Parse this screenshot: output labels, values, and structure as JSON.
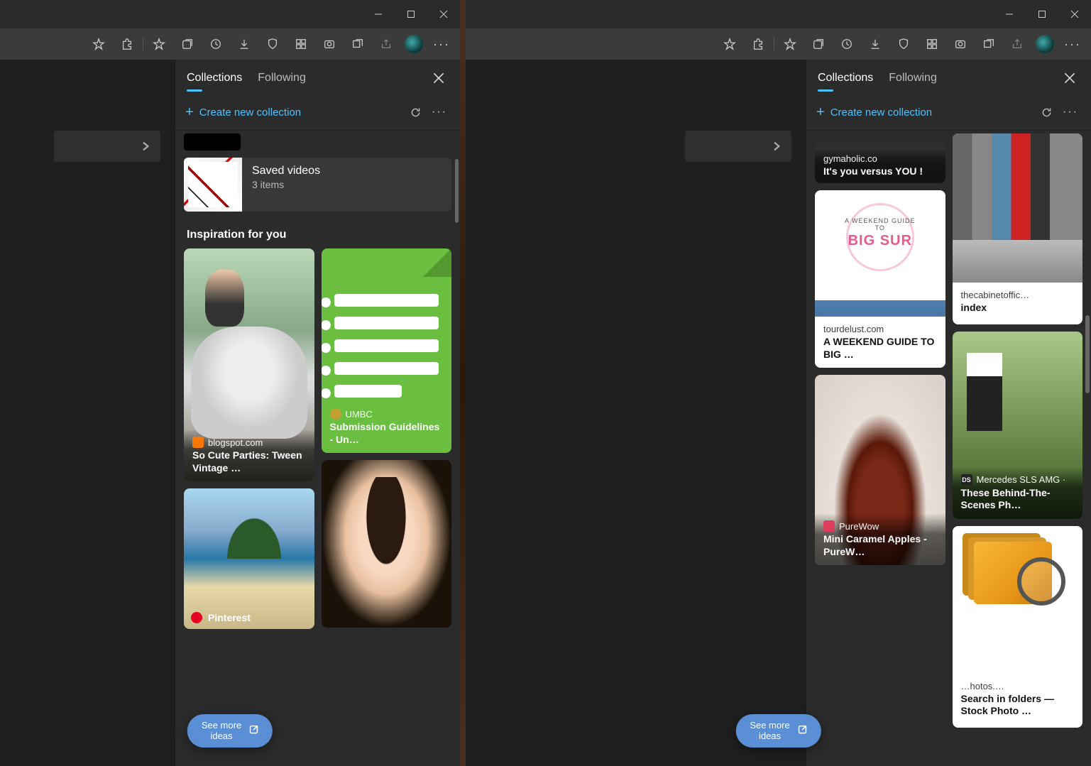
{
  "titlebar": {
    "minimize": "–",
    "maximize": "☐",
    "close": "✕"
  },
  "panel": {
    "tabs": {
      "collections": "Collections",
      "following": "Following"
    },
    "create": "Create new collection",
    "saved_videos": {
      "title": "Saved videos",
      "count": "3 items"
    },
    "inspiration_heading": "Inspiration for you",
    "see_more": "See more\nideas"
  },
  "cards_left": {
    "horse": {
      "source": "blogspot.com",
      "title": "So Cute Parties: Tween Vintage …"
    },
    "greendoc": {
      "source": "UMBC",
      "title": "Submission Guidelines - Un…"
    },
    "beach_badge": "Pinterest"
  },
  "cards_right": {
    "gym": {
      "source": "gymaholic.co",
      "title": "It's you versus YOU !"
    },
    "bigsur": {
      "bigtxt": "BIG SUR",
      "source": "tourdelust.com",
      "title": "A WEEKEND GUIDE TO BIG …"
    },
    "apples": {
      "source": "PureWow",
      "title": "Mini Caramel Apples - PureW…"
    },
    "binders": {
      "source": "thecabinetoffic…",
      "title": "index"
    },
    "bts": {
      "source": "Mercedes SLS AMG ·",
      "title": "These Behind-The-Scenes Ph…"
    },
    "folders": {
      "source": "…hotos.…",
      "title": "Search in folders — Stock Photo …"
    }
  }
}
